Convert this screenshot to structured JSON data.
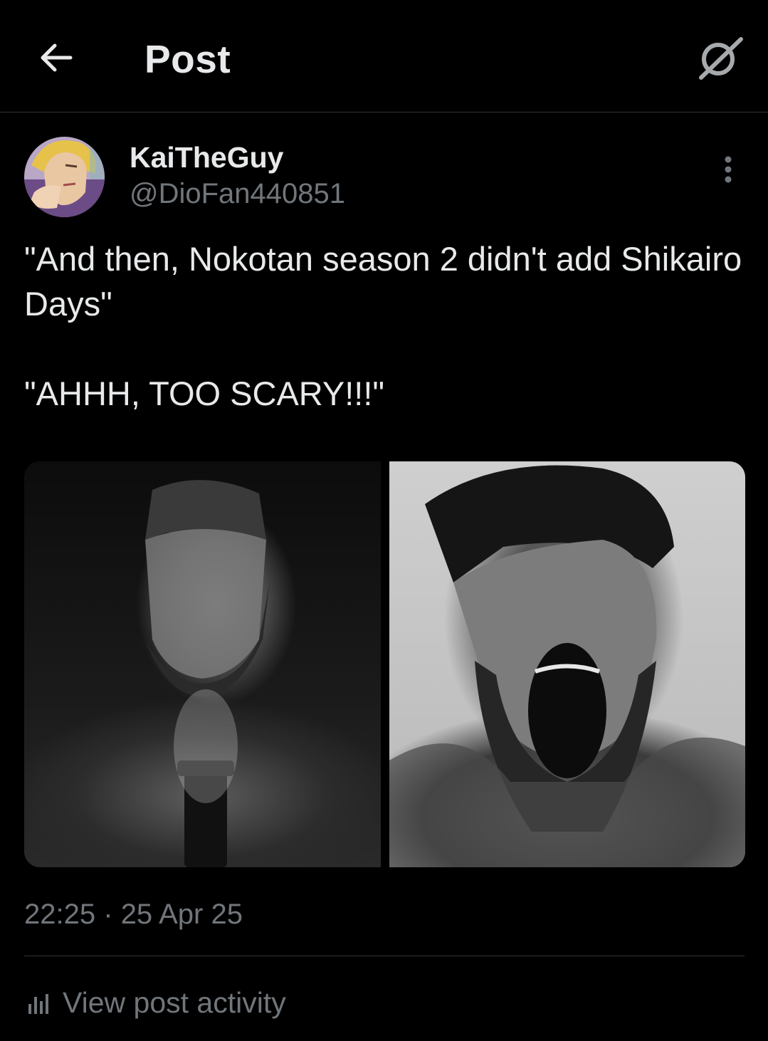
{
  "header": {
    "title": "Post",
    "back_icon": "arrow-left-icon",
    "grok_icon": "grok-icon"
  },
  "post": {
    "author": {
      "display_name": "KaiTheGuy",
      "handle": "@DioFan440851"
    },
    "text_lines": [
      "\"And then, Nokotan season 2 didn't add Shikairo Days\"",
      "\"AHHH, TOO SCARY!!!\""
    ],
    "timestamp": {
      "time": "22:25",
      "separator": "·",
      "date": "25 Apr 25"
    },
    "activity_label": "View post activity"
  },
  "colors": {
    "background": "#000000",
    "primary_text": "#e7e9ea",
    "secondary_text": "#71767b",
    "divider": "#2f3336"
  }
}
